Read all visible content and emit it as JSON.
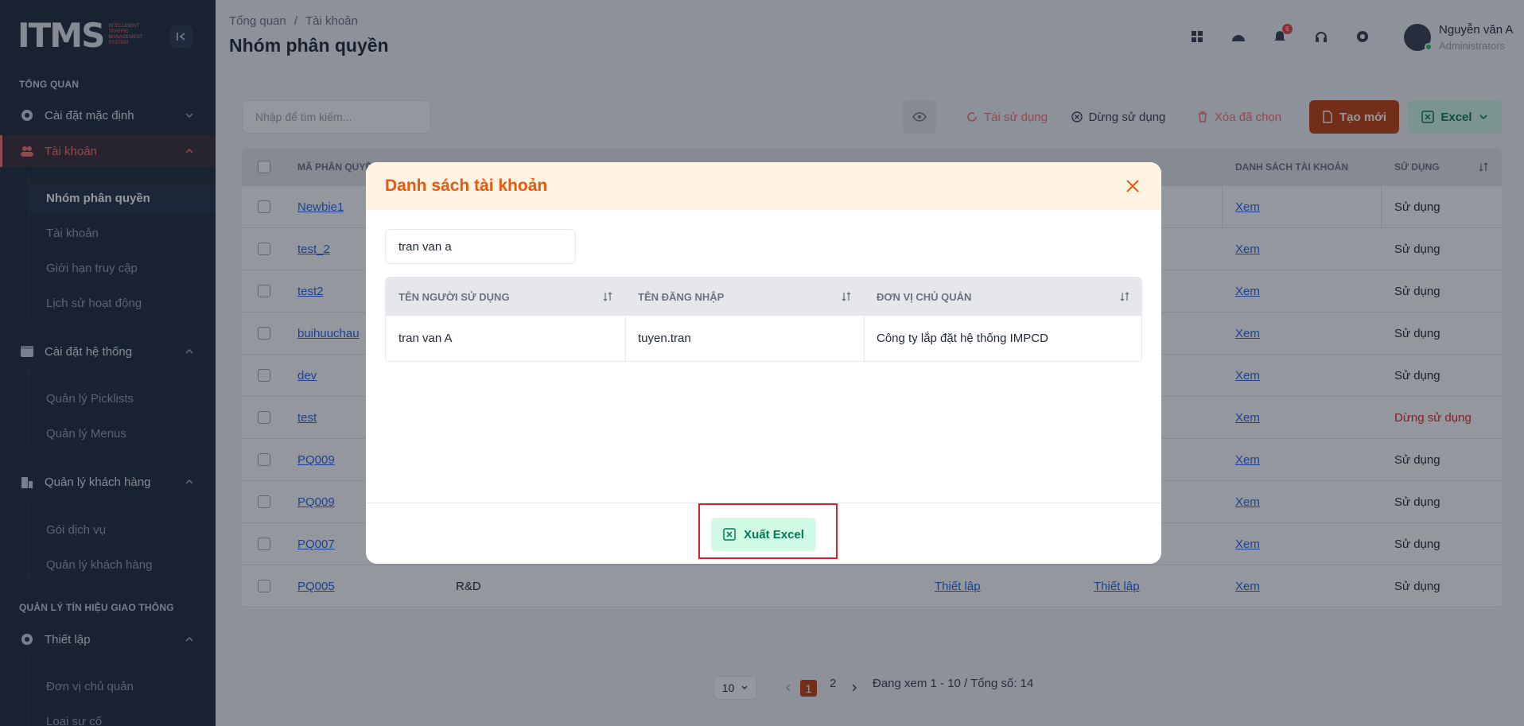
{
  "sidebar": {
    "logo_mark": "ITMS",
    "logo_caption": "INTELLIGENT TRAFFIC MANAGEMENT SYSTEM",
    "section_overview": "TỔNG QUAN",
    "section_traffic": "QUẢN LÝ TÍN HIỆU GIAO THÔNG",
    "items": [
      {
        "label": "Cài đặt mặc định"
      },
      {
        "label": "Tài khoản"
      },
      {
        "label": "Cài đặt hệ thống"
      },
      {
        "label": "Quản lý khách hàng"
      },
      {
        "label": "Thiết lập"
      }
    ],
    "subitems": [
      {
        "label": "Nhóm phân quyền"
      },
      {
        "label": "Tài khoản"
      },
      {
        "label": "Giới hạn truy cập"
      },
      {
        "label": "Lịch sử hoạt động"
      },
      {
        "label": "Quản lý Picklists"
      },
      {
        "label": "Quản lý Menus"
      },
      {
        "label": "Gói dịch vụ"
      },
      {
        "label": "Quản lý khách hàng"
      },
      {
        "label": "Đơn vị chủ quản"
      },
      {
        "label": "Loại sự cố"
      }
    ]
  },
  "header": {
    "breadcrumb": [
      "Tổng quan",
      "/",
      "Tài khoản"
    ],
    "title": "Nhóm phân quyền",
    "notification_count": "6",
    "user_name": "Nguyễn văn A",
    "user_role": "Administrators"
  },
  "toolbar": {
    "search_placeholder": "Nhập để tìm kiếm...",
    "reuse_label": "Tái sử dụng",
    "stop_label": "Dừng sử dụng",
    "delete_label": "Xóa đã chọn",
    "create_label": "Tạo mới",
    "excel_label": "Excel"
  },
  "table": {
    "headers": {
      "code": "MÃ PHÂN QUYỀN",
      "accounts": "DANH SÁCH TÀI KHOẢN",
      "usage": "SỬ DỤNG"
    },
    "rows": [
      {
        "code": "Newbie1",
        "view": "Xem",
        "status": "Sử dụng"
      },
      {
        "code": "test_2",
        "view": "Xem",
        "status": "Sử dụng"
      },
      {
        "code": "test2",
        "view": "Xem",
        "status": "Sử dụng"
      },
      {
        "code": "buihuuchau",
        "view": "Xem",
        "status": "Sử dụng"
      },
      {
        "code": "dev",
        "view": "Xem",
        "status": "Sử dụng"
      },
      {
        "code": "test",
        "view": "Xem",
        "status": "Dừng sử dụng"
      },
      {
        "code": "PQ009",
        "view": "Xem",
        "status": "Sử dụng"
      },
      {
        "code": "PQ009",
        "view": "Xem",
        "status": "Sử dụng"
      },
      {
        "code": "PQ007",
        "view": "Xem",
        "status": "Sử dụng"
      },
      {
        "code": "PQ005",
        "name": "R&D",
        "setup1": "Thiết lập",
        "setup2": "Thiết lập",
        "view": "Xem",
        "status": "Sử dụng"
      }
    ]
  },
  "pagination": {
    "page_size": "10",
    "current": "1",
    "next_page": "2",
    "summary": "Đang xem 1 - 10 / Tổng số: 14"
  },
  "modal": {
    "title": "Danh sách tài khoản",
    "search_value": "tran van a",
    "columns": [
      "TÊN NGƯỜI SỬ DỤNG",
      "TÊN ĐĂNG NHẬP",
      "ĐƠN VỊ CHỦ QUẢN"
    ],
    "rows": [
      {
        "user": "tran van A",
        "login": "tuyen.tran",
        "unit": "Công ty lắp đặt hệ thống IMPCD"
      }
    ],
    "export_label": "Xuất Excel"
  },
  "colors": {
    "accent": "#c2410c",
    "modal_title": "#ea580c",
    "excel_bg": "#d1fae5",
    "excel_text": "#047857",
    "highlight": "#e11d2a"
  }
}
